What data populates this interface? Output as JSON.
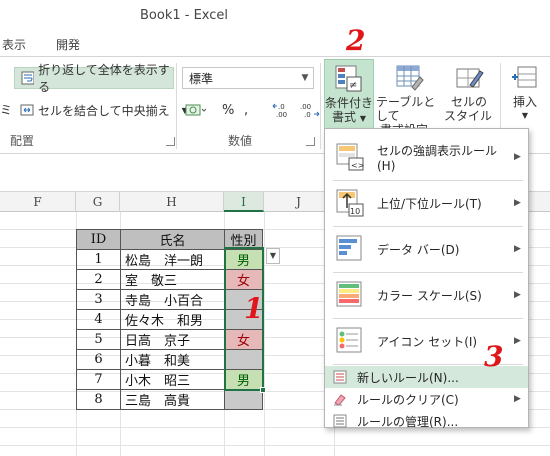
{
  "window": {
    "title": "Book1 - Excel"
  },
  "tabs": [
    "表示",
    "開発"
  ],
  "ribbon": {
    "wrap_text": "折り返して全体を表示する",
    "merge_center": "セルを結合して中央揃え",
    "number_format": "標準",
    "percent": "%",
    "comma": ",",
    "inc_decimal": "←.0 .00",
    "dec_decimal": ".00 →.0",
    "group_alignment": "配置",
    "group_number": "数値",
    "cond_format": [
      "条件付き",
      "書式"
    ],
    "format_table": [
      "テーブルとして",
      "書式設定"
    ],
    "cell_styles": [
      "セルの",
      "スタイル"
    ],
    "insert": "挿入",
    "left_fragment": "ミ"
  },
  "columns": [
    "F",
    "G",
    "H",
    "I",
    "J"
  ],
  "table": {
    "headers": [
      "ID",
      "氏名",
      "性別"
    ],
    "rows": [
      {
        "id": "1",
        "name": "松島　洋一朗",
        "gender": "男",
        "fmt": "male"
      },
      {
        "id": "2",
        "name": "室　敬三",
        "gender": "女",
        "fmt": "female"
      },
      {
        "id": "3",
        "name": "寺島　小百合",
        "gender": "",
        "fmt": "empty"
      },
      {
        "id": "4",
        "name": "佐々木　和男",
        "gender": "",
        "fmt": "empty"
      },
      {
        "id": "5",
        "name": "日高　京子",
        "gender": "女",
        "fmt": "female"
      },
      {
        "id": "6",
        "name": "小暮　和美",
        "gender": "",
        "fmt": "empty"
      },
      {
        "id": "7",
        "name": "小木　昭三",
        "gender": "男",
        "fmt": "male"
      },
      {
        "id": "8",
        "name": "三島　高貴",
        "gender": "",
        "fmt": "empty"
      }
    ]
  },
  "menu": {
    "items": [
      {
        "label": "セルの強調表示ルール(H)",
        "icon": "highlight-rules-icon"
      },
      {
        "label": "上位/下位ルール(T)",
        "icon": "top-bottom-rules-icon"
      },
      {
        "label": "データ バー(D)",
        "icon": "data-bars-icon"
      },
      {
        "label": "カラー スケール(S)",
        "icon": "color-scales-icon"
      },
      {
        "label": "アイコン セット(I)",
        "icon": "icon-sets-icon"
      }
    ],
    "small_items": [
      {
        "label": "新しいルール(N)...",
        "icon": "new-rule-icon"
      },
      {
        "label": "ルールのクリア(C)",
        "icon": "clear-rules-icon"
      },
      {
        "label": "ルールの管理(R)...",
        "icon": "manage-rules-icon"
      }
    ]
  },
  "annotations": [
    "1",
    "2",
    "3"
  ],
  "colors": {
    "accent": "#217346",
    "male_fill": "#c6e0b4",
    "female_fill": "#e6b9b8",
    "annotation": "#e0161b"
  }
}
